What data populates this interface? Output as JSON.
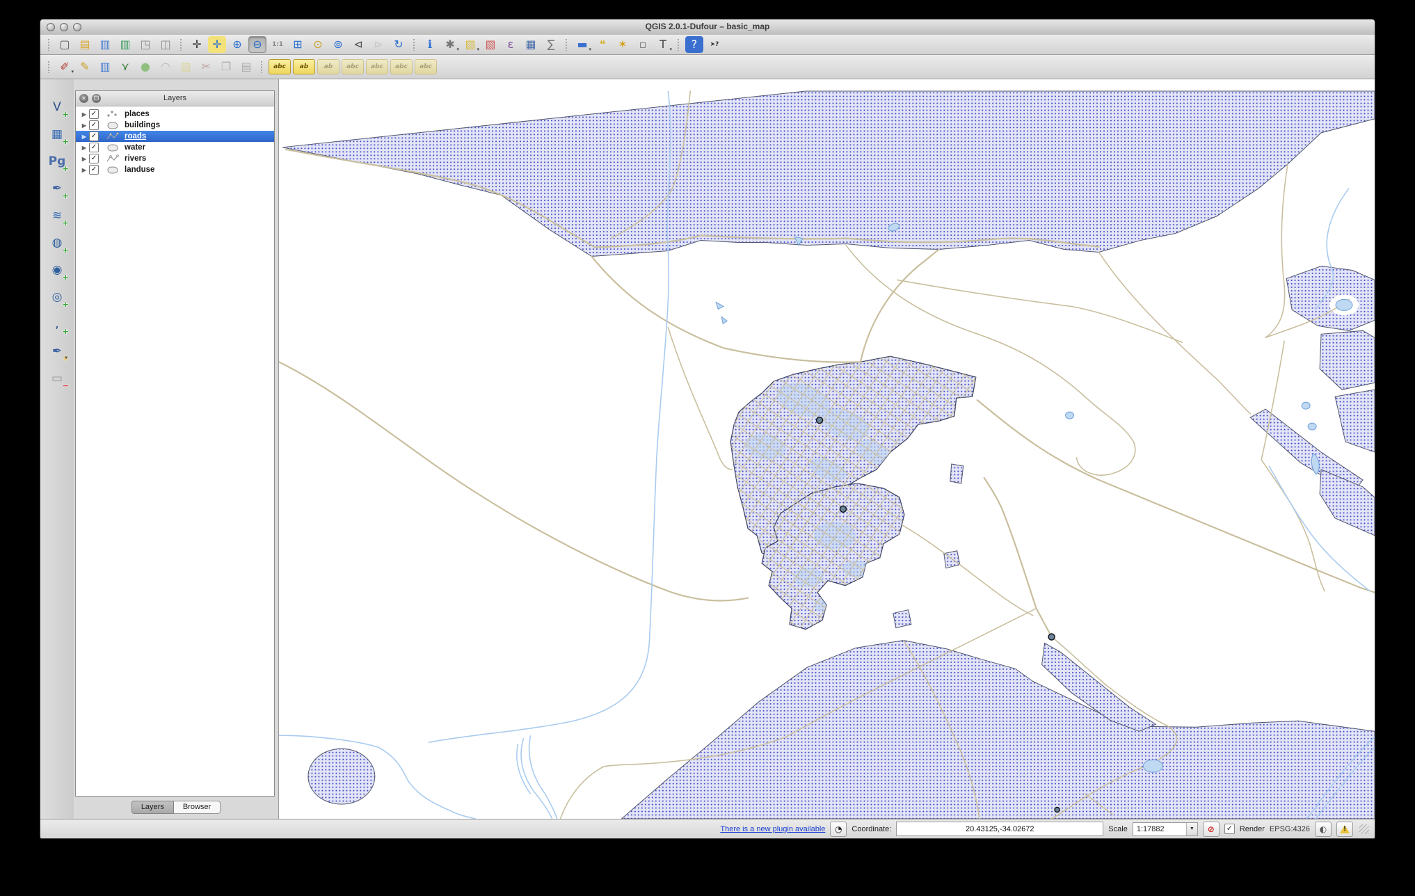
{
  "window": {
    "title": "QGIS 2.0.1-Dufour – basic_map"
  },
  "toolbar_main": {
    "groups": [
      {
        "items": [
          {
            "name": "new-project",
            "glyph": "▢",
            "color": "#555555"
          },
          {
            "name": "open-project",
            "glyph": "▤",
            "color": "#d9a62b"
          },
          {
            "name": "save-project",
            "glyph": "▥",
            "color": "#4a7fd4"
          },
          {
            "name": "save-project-as",
            "glyph": "▥",
            "color": "#3f9f63"
          },
          {
            "name": "new-print-composer",
            "glyph": "◳",
            "color": "#8a8a8a"
          },
          {
            "name": "composer-manager",
            "glyph": "◫",
            "color": "#8a8a8a"
          }
        ]
      },
      {
        "items": [
          {
            "name": "pan-map",
            "glyph": "✛",
            "color": "#333333"
          },
          {
            "name": "pan-to-selection",
            "glyph": "✛",
            "color": "#2a6fd0",
            "bg": "#f3e27a"
          },
          {
            "name": "zoom-in",
            "glyph": "⊕",
            "color": "#2a6fd0"
          },
          {
            "name": "zoom-out",
            "glyph": "⊖",
            "color": "#2a6fd0",
            "active": true
          },
          {
            "name": "zoom-actual-size",
            "glyph": "1:1",
            "color": "#888888",
            "small": true
          },
          {
            "name": "zoom-full-extent",
            "glyph": "⊞",
            "color": "#2a6fd0"
          },
          {
            "name": "zoom-to-selection",
            "glyph": "⊙",
            "color": "#c9a227"
          },
          {
            "name": "zoom-to-layer",
            "glyph": "⊚",
            "color": "#2a6fd0"
          },
          {
            "name": "zoom-last",
            "glyph": "⊲",
            "color": "#555555"
          },
          {
            "name": "zoom-next",
            "glyph": "⊳",
            "color": "#aaaaaa",
            "dim": true
          },
          {
            "name": "map-refresh",
            "glyph": "↻",
            "color": "#2a6fd0"
          }
        ]
      },
      {
        "items": [
          {
            "name": "identify-features",
            "glyph": "ℹ",
            "color": "#2a6fd0"
          },
          {
            "name": "run-feature-action",
            "glyph": "✱",
            "color": "#777777",
            "caret": true
          },
          {
            "name": "select-features",
            "glyph": "▧",
            "color": "#d8b93c",
            "caret": true
          },
          {
            "name": "deselect-features",
            "glyph": "▧",
            "color": "#cc5555"
          },
          {
            "name": "select-by-expression",
            "glyph": "ε",
            "color": "#7a4a9a"
          },
          {
            "name": "open-attribute-table",
            "glyph": "▦",
            "color": "#4a6ea9"
          },
          {
            "name": "field-calculator",
            "glyph": "∑",
            "color": "#777777"
          }
        ]
      },
      {
        "items": [
          {
            "name": "measure",
            "glyph": "▬",
            "color": "#3a6fd0",
            "caret": true
          },
          {
            "name": "map-tips",
            "glyph": "❝",
            "color": "#d4b42a"
          },
          {
            "name": "new-bookmark",
            "glyph": "✶",
            "color": "#d4a017"
          },
          {
            "name": "show-bookmarks",
            "glyph": "▫",
            "color": "#777777"
          },
          {
            "name": "text-annotation",
            "glyph": "T",
            "color": "#444444",
            "caret": true
          }
        ]
      },
      {
        "items": [
          {
            "name": "help-contents",
            "glyph": "?",
            "color": "#ffffff",
            "bg": "#3a6fd0"
          },
          {
            "name": "whats-this",
            "glyph": "➤?",
            "color": "#333333",
            "small": true
          }
        ]
      }
    ]
  },
  "toolbar_edit": {
    "groups": [
      {
        "items": [
          {
            "name": "current-edits",
            "glyph": "✐",
            "color": "#b03a2e",
            "caret": true
          },
          {
            "name": "toggle-editing",
            "glyph": "✎",
            "color": "#c9a227"
          },
          {
            "name": "save-layer-edits",
            "glyph": "▥",
            "color": "#4a7fd4"
          },
          {
            "name": "add-feature",
            "glyph": "⋎",
            "color": "#3a7f3a"
          },
          {
            "name": "move-feature",
            "glyph": "●",
            "color": "#8fbf7f"
          },
          {
            "name": "node-tool",
            "glyph": "◠",
            "color": "#888888",
            "dim": true
          },
          {
            "name": "delete-selected",
            "glyph": "▧",
            "color": "#d8c94a",
            "dim": true
          },
          {
            "name": "cut-features",
            "glyph": "✂",
            "color": "#884444",
            "dim": true
          },
          {
            "name": "copy-features",
            "glyph": "❐",
            "color": "#666666",
            "dim": true
          },
          {
            "name": "paste-features",
            "glyph": "▤",
            "color": "#666666",
            "dim": true
          }
        ]
      },
      {
        "items": [
          {
            "name": "labeling-options",
            "glyph": "abc",
            "chip": true
          },
          {
            "name": "label-pin",
            "glyph": "ab",
            "chip": true
          },
          {
            "name": "label-highlight",
            "glyph": "ab",
            "chip": true,
            "dim": true
          },
          {
            "name": "label-move",
            "glyph": "abc",
            "chip": true,
            "dim": true
          },
          {
            "name": "label-rotate",
            "glyph": "abc",
            "chip": true,
            "dim": true
          },
          {
            "name": "label-change",
            "glyph": "abc",
            "chip": true,
            "dim": true
          },
          {
            "name": "label-properties",
            "glyph": "abc",
            "chip": true,
            "dim": true
          }
        ]
      }
    ]
  },
  "left_toolbar": {
    "items": [
      {
        "name": "add-vector-layer",
        "glyph": "V",
        "color": "#2c4f8a",
        "badge": "+",
        "badge_color": "#2ea52e"
      },
      {
        "name": "add-raster-layer",
        "glyph": "▦",
        "color": "#3b6fb5",
        "badge": "+",
        "badge_color": "#2ea52e"
      },
      {
        "name": "add-postgis-layer",
        "glyph": "Pg",
        "color": "#4a6ea9",
        "small": true,
        "badge": "+",
        "badge_color": "#2ea52e"
      },
      {
        "name": "add-spatialite-layer",
        "glyph": "✒",
        "color": "#3b5fa0",
        "badge": "+",
        "badge_color": "#2ea52e"
      },
      {
        "name": "add-mssql-layer",
        "glyph": "≋",
        "color": "#3b6fb5",
        "badge": "+",
        "badge_color": "#2ea52e"
      },
      {
        "name": "add-wms-layer",
        "glyph": "◍",
        "color": "#2f5f9e",
        "badge": "+",
        "badge_color": "#2ea52e"
      },
      {
        "name": "add-wcs-layer",
        "glyph": "◉",
        "color": "#2f5f9e",
        "badge": "+",
        "badge_color": "#2ea52e"
      },
      {
        "name": "add-wfs-layer",
        "glyph": "◎",
        "color": "#2f5f9e",
        "badge": "+",
        "badge_color": "#2ea52e"
      },
      {
        "name": "add-delimited-text-layer",
        "glyph": ",",
        "color": "#2b4f86",
        "badge": "+",
        "badge_color": "#2ea52e"
      },
      {
        "name": "new-spatialite-layer",
        "glyph": "✒",
        "color": "#3b5fa0",
        "badge": "✳",
        "badge_color": "#d4a017",
        "caret": true
      },
      {
        "name": "remove-layer",
        "glyph": "▭",
        "color": "#999999",
        "badge": "−",
        "badge_color": "#d03030"
      }
    ]
  },
  "layers_panel": {
    "title": "Layers",
    "header_icons": [
      "close-icon",
      "float-icon"
    ],
    "items": [
      {
        "label": "places",
        "type": "point",
        "checked": true,
        "selected": false
      },
      {
        "label": "buildings",
        "type": "polygon",
        "checked": true,
        "selected": false
      },
      {
        "label": "roads",
        "type": "line",
        "checked": true,
        "selected": true
      },
      {
        "label": "water",
        "type": "polygon",
        "checked": true,
        "selected": false
      },
      {
        "label": "rivers",
        "type": "line",
        "checked": true,
        "selected": false
      },
      {
        "label": "landuse",
        "type": "polygon",
        "checked": true,
        "selected": false
      }
    ],
    "tabs": [
      {
        "label": "Layers",
        "active": true
      },
      {
        "label": "Browser",
        "active": false
      }
    ]
  },
  "map": {
    "colors": {
      "landuse_fill": "#e3e4f6",
      "landuse_dot": "#3a46c4",
      "landuse_stroke": "#50556e",
      "road": "#c9bf9e",
      "river": "#a9cbf0",
      "water_fill": "#bfd9f2",
      "water_stroke": "#6f9fd8",
      "place_fill": "#6c8699",
      "background": "#ffffff"
    }
  },
  "statusbar": {
    "plugin_link": "There is a new plugin available",
    "coordinate_label": "Coordinate:",
    "coordinate_value": "20.43125,-34.02672",
    "scale_label": "Scale",
    "scale_value": "1:17882",
    "render_label": "Render",
    "epsg_label": "EPSG:4326"
  }
}
